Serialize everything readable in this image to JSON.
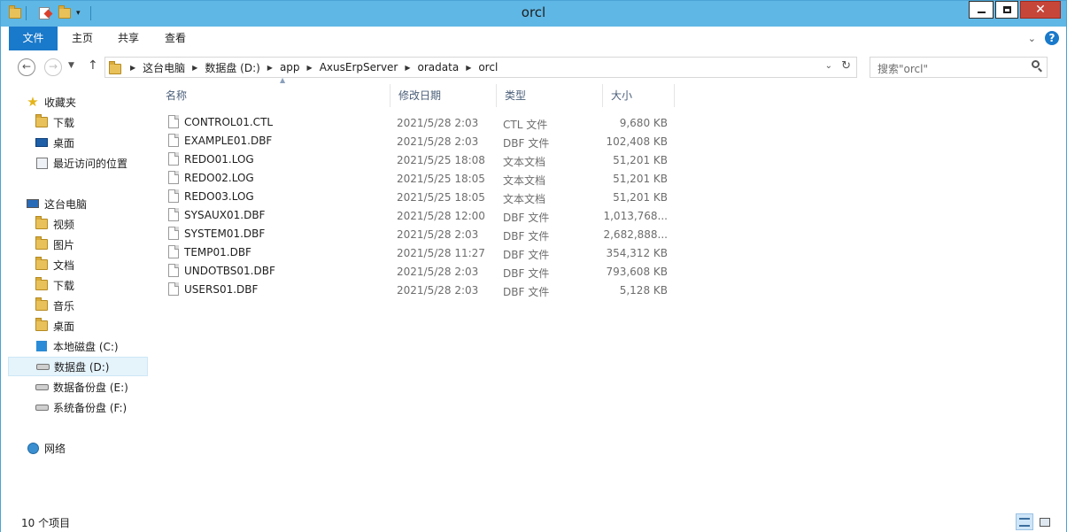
{
  "window": {
    "title": "orcl"
  },
  "ribbon": {
    "tabs": [
      "文件",
      "主页",
      "共享",
      "查看"
    ]
  },
  "address": {
    "crumbs": [
      "这台电脑",
      "数据盘 (D:)",
      "app",
      "AxusErpServer",
      "oradata",
      "orcl"
    ]
  },
  "search": {
    "placeholder": "搜索\"orcl\""
  },
  "nav": {
    "favorites": {
      "label": "收藏夹",
      "items": [
        "下载",
        "桌面",
        "最近访问的位置"
      ]
    },
    "computer": {
      "label": "这台电脑",
      "items": [
        "视频",
        "图片",
        "文档",
        "下载",
        "音乐",
        "桌面",
        "本地磁盘 (C:)",
        "数据盘 (D:)",
        "数据备份盘 (E:)",
        "系统备份盘 (F:)"
      ]
    },
    "network": {
      "label": "网络"
    },
    "selected": "数据盘 (D:)"
  },
  "columns": {
    "name": "名称",
    "date": "修改日期",
    "type": "类型",
    "size": "大小"
  },
  "files": [
    {
      "name": "CONTROL01.CTL",
      "date": "2021/5/28 2:03",
      "type": "CTL 文件",
      "size": "9,680 KB"
    },
    {
      "name": "EXAMPLE01.DBF",
      "date": "2021/5/28 2:03",
      "type": "DBF 文件",
      "size": "102,408 KB"
    },
    {
      "name": "REDO01.LOG",
      "date": "2021/5/25 18:08",
      "type": "文本文档",
      "size": "51,201 KB"
    },
    {
      "name": "REDO02.LOG",
      "date": "2021/5/25 18:05",
      "type": "文本文档",
      "size": "51,201 KB"
    },
    {
      "name": "REDO03.LOG",
      "date": "2021/5/25 18:05",
      "type": "文本文档",
      "size": "51,201 KB"
    },
    {
      "name": "SYSAUX01.DBF",
      "date": "2021/5/28 12:00",
      "type": "DBF 文件",
      "size": "1,013,768..."
    },
    {
      "name": "SYSTEM01.DBF",
      "date": "2021/5/28 2:03",
      "type": "DBF 文件",
      "size": "2,682,888..."
    },
    {
      "name": "TEMP01.DBF",
      "date": "2021/5/28 11:27",
      "type": "DBF 文件",
      "size": "354,312 KB"
    },
    {
      "name": "UNDOTBS01.DBF",
      "date": "2021/5/28 2:03",
      "type": "DBF 文件",
      "size": "793,608 KB"
    },
    {
      "name": "USERS01.DBF",
      "date": "2021/5/28 2:03",
      "type": "DBF 文件",
      "size": "5,128 KB"
    }
  ],
  "status": {
    "count": "10 个项目"
  },
  "colors": {
    "titlebar": "#5fb7e5",
    "file_tab": "#1979ca",
    "close": "#c7463a",
    "selection": "#e5f3fb"
  }
}
